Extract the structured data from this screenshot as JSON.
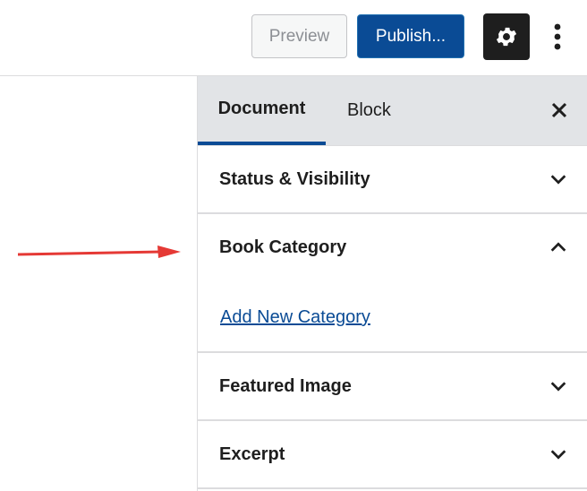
{
  "topbar": {
    "preview_label": "Preview",
    "publish_label": "Publish...",
    "settings_icon": "gear-icon",
    "more_icon": "vertical-ellipsis-icon"
  },
  "sidebar": {
    "tabs": [
      {
        "label": "Document",
        "active": true
      },
      {
        "label": "Block",
        "active": false
      }
    ],
    "close_icon": "close-icon",
    "panels": [
      {
        "title": "Status & Visibility",
        "expanded": false
      },
      {
        "title": "Book Category",
        "expanded": true,
        "content": {
          "link_label": "Add New Category"
        }
      },
      {
        "title": "Featured Image",
        "expanded": false
      },
      {
        "title": "Excerpt",
        "expanded": false
      }
    ]
  },
  "colors": {
    "accent": "#0a4b95",
    "arrow": "#e53935"
  }
}
